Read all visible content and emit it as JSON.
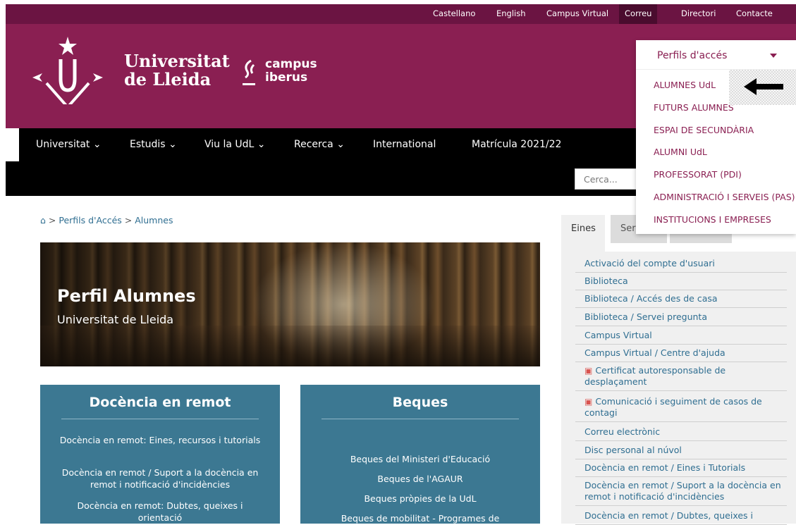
{
  "topbar": {
    "links": [
      "Castellano",
      "English",
      "Campus Virtual",
      "Correu",
      "Directori",
      "Contacte"
    ]
  },
  "header": {
    "uni_line1": "Universitat",
    "uni_line2": "de Lleida",
    "campus_line1": "campus",
    "campus_line2": "iberus"
  },
  "mainnav": {
    "items": [
      "Universitat ⌄",
      "Estudis ⌄",
      "Viu la UdL ⌄",
      "Recerca ⌄",
      "International",
      "Matrícula 2021/22"
    ]
  },
  "search": {
    "placeholder": "Cerca..."
  },
  "breadcrumb": {
    "home_icon": "home-icon",
    "items": [
      "Perfils d'Accés",
      "Alumnes"
    ]
  },
  "hero": {
    "title": "Perfil Alumnes",
    "subtitle": "Universitat de Lleida"
  },
  "cards": [
    {
      "title": "Docència en remot",
      "links": [
        "Docència en remot: Eines, recursos i tutorials",
        "Docència en remot / Suport a la docència en remot i notificació d'incidències",
        "Docència en remot: Dubtes, queixes i orientació"
      ]
    },
    {
      "title": "Beques",
      "links": [
        "Beques del Ministeri d'Educació",
        "Beques de l'AGAUR",
        "Beques pròpies de la UdL",
        "Beques de mobilitat - Programes de"
      ]
    }
  ],
  "sidebar": {
    "tabs": [
      "Eines",
      "Ser"
    ],
    "links": [
      "Activació del compte d'usuari",
      "Biblioteca",
      "Biblioteca / Accés des de casa",
      "Biblioteca / Servei pregunta",
      "Campus Virtual",
      "Campus Virtual / Centre d'ajuda",
      "Certificat autoresponsable de desplaçament",
      "Comunicació i seguiment de casos de contagi",
      "Correu electrònic",
      "Disc personal al núvol",
      "Docència en remot / Eines i Tutorials",
      "Docència en remot / Suport a la docència en remot i notificació d'incidències",
      "Docència en remot / Dubtes, queixes i"
    ]
  },
  "dropdown": {
    "title": "Perfils d'accés",
    "items": [
      "ALUMNES UdL",
      "FUTURS ALUMNES",
      "ESPAI DE SECUNDÀRIA",
      "ALUMNI UdL",
      "PROFESSORAT (PDI)",
      "ADMINISTRACIÓ I SERVEIS (PAS)",
      "INSTITUCIONS I EMPRESES"
    ]
  },
  "colors": {
    "brand": "#8a1f52",
    "topbar": "#6b1442",
    "card": "#3c7892",
    "link": "#2f6e91"
  }
}
